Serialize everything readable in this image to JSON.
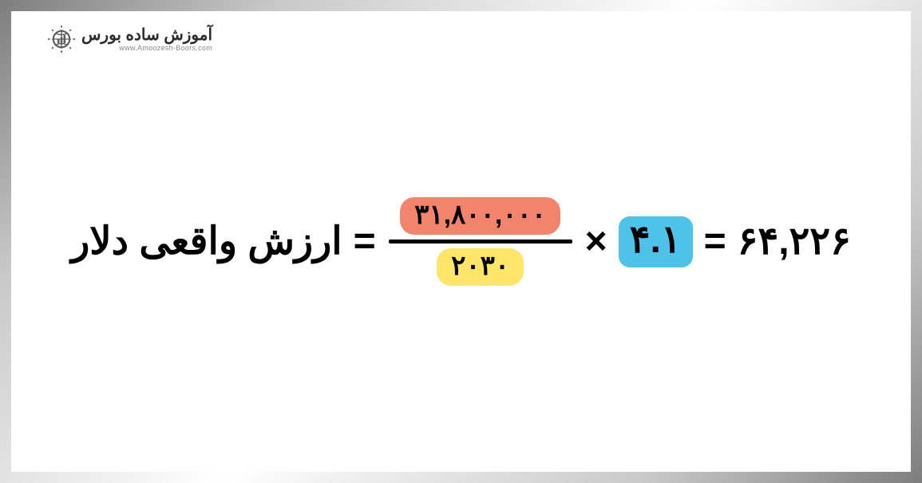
{
  "logo": {
    "title": "آموزش ساده بورس",
    "subtitle": "www.Amoozesh-Boors.com"
  },
  "formula": {
    "lhs_label": "ارزش واقعی دلار",
    "equals1": "=",
    "numerator": "۳۱,۸۰۰,۰۰۰",
    "denominator": "۲۰۳۰",
    "times": "×",
    "multiplier": "۴.۱",
    "equals2": "=",
    "result": "۶۴,۲۲۶"
  }
}
